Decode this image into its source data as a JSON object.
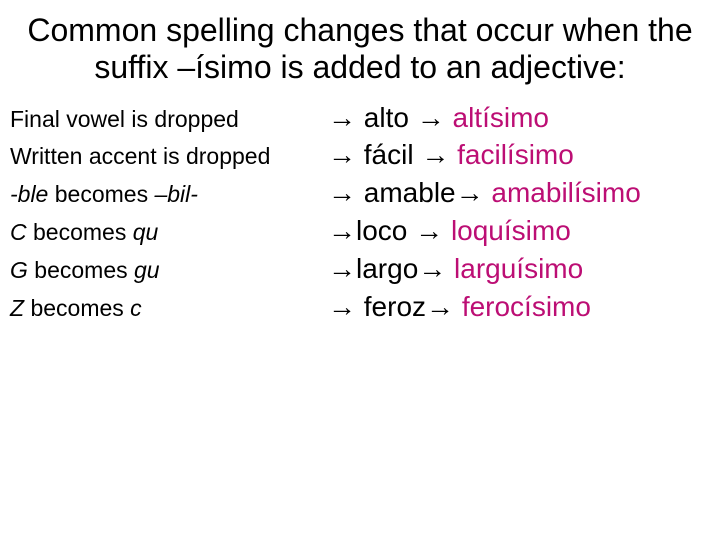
{
  "title": "Common spelling changes that occur when the suffix –ísimo is added to an adjective:",
  "arrow": "→",
  "rows": [
    {
      "rule_segments": [
        {
          "text": "Final vowel is dropped",
          "italic": false
        }
      ],
      "base": "alto",
      "result": "altísimo",
      "lead_space": " ",
      "mid_space": " "
    },
    {
      "rule_segments": [
        {
          "text": "Written accent is dropped",
          "italic": false
        }
      ],
      "base": "fácil",
      "result": "facilísimo",
      "lead_space": " ",
      "mid_space": " "
    },
    {
      "rule_segments": [
        {
          "text": "-ble",
          "italic": true
        },
        {
          "text": "  becomes ",
          "italic": false
        },
        {
          "text": "–bil-",
          "italic": true
        }
      ],
      "base": "amable",
      "result": "amabilísimo",
      "lead_space": " ",
      "mid_space": ""
    },
    {
      "rule_segments": [
        {
          "text": "C",
          "italic": true
        },
        {
          "text": "  becomes ",
          "italic": false
        },
        {
          "text": "qu",
          "italic": true
        }
      ],
      "base": "loco",
      "result": "loquísimo",
      "lead_space": "",
      "mid_space": " "
    },
    {
      "rule_segments": [
        {
          "text": "G",
          "italic": true
        },
        {
          "text": "  becomes ",
          "italic": false
        },
        {
          "text": "gu",
          "italic": true
        }
      ],
      "base": "largo",
      "result": "larguísimo",
      "lead_space": "",
      "mid_space": ""
    },
    {
      "rule_segments": [
        {
          "text": "Z",
          "italic": true
        },
        {
          "text": "  becomes ",
          "italic": false
        },
        {
          "text": "c",
          "italic": true
        }
      ],
      "base": "feroz",
      "result": "ferocísimo",
      "lead_space": " ",
      "mid_space": ""
    }
  ]
}
